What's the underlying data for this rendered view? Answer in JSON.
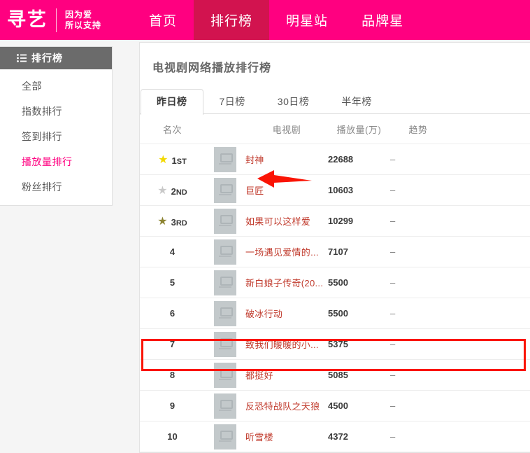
{
  "nav": {
    "logo_text": "寻艺",
    "slogan": "因为爱\n所以支持",
    "items": [
      {
        "label": "首页",
        "active": false
      },
      {
        "label": "排行榜",
        "active": true
      },
      {
        "label": "明星站",
        "active": false
      },
      {
        "label": "品牌星",
        "active": false
      }
    ]
  },
  "sidebar": {
    "header": "排行榜",
    "header_icon": "list-icon",
    "items": [
      {
        "label": "全部",
        "active": false
      },
      {
        "label": "指数排行",
        "active": false
      },
      {
        "label": "签到排行",
        "active": false
      },
      {
        "label": "播放量排行",
        "active": true
      },
      {
        "label": "粉丝排行",
        "active": false
      }
    ]
  },
  "panel": {
    "title": "电视剧网络播放排行榜",
    "tabs": [
      {
        "label": "昨日榜",
        "active": true
      },
      {
        "label": "7日榜",
        "active": false
      },
      {
        "label": "30日榜",
        "active": false
      },
      {
        "label": "半年榜",
        "active": false
      }
    ],
    "columns": [
      "名次",
      "电视剧",
      "播放量(万)",
      "趋势"
    ],
    "rows": [
      {
        "rank": "1",
        "rank_suffix": "ST",
        "medal": "★",
        "medal_class": "m1",
        "thumb": "image-placeholder-icon",
        "name": "封神",
        "views": "22688",
        "trend": "–"
      },
      {
        "rank": "2",
        "rank_suffix": "ND",
        "medal": "★",
        "medal_class": "m2",
        "thumb": "image-placeholder-icon",
        "name": "巨匠",
        "views": "10603",
        "trend": "–"
      },
      {
        "rank": "3",
        "rank_suffix": "RD",
        "medal": "★",
        "medal_class": "m3",
        "thumb": "image-placeholder-icon",
        "name": "如果可以这样爱",
        "views": "10299",
        "trend": "–"
      },
      {
        "rank": "4",
        "rank_suffix": "",
        "medal": "",
        "medal_class": "",
        "thumb": "image-placeholder-icon",
        "name": "一场遇见爱情的...",
        "views": "7107",
        "trend": "–"
      },
      {
        "rank": "5",
        "rank_suffix": "",
        "medal": "",
        "medal_class": "",
        "thumb": "image-placeholder-icon",
        "name": "新白娘子传奇(20...",
        "views": "5500",
        "trend": "–"
      },
      {
        "rank": "6",
        "rank_suffix": "",
        "medal": "",
        "medal_class": "",
        "thumb": "image-placeholder-icon",
        "name": "破冰行动",
        "views": "5500",
        "trend": "–"
      },
      {
        "rank": "7",
        "rank_suffix": "",
        "medal": "",
        "medal_class": "",
        "thumb": "image-placeholder-icon",
        "name": "致我们暖暖的小...",
        "views": "5375",
        "trend": "–"
      },
      {
        "rank": "8",
        "rank_suffix": "",
        "medal": "",
        "medal_class": "",
        "thumb": "image-placeholder-icon",
        "name": "都挺好",
        "views": "5085",
        "trend": "–"
      },
      {
        "rank": "9",
        "rank_suffix": "",
        "medal": "",
        "medal_class": "",
        "thumb": "image-placeholder-icon",
        "name": "反恐特战队之天狼",
        "views": "4500",
        "trend": "–"
      },
      {
        "rank": "10",
        "rank_suffix": "",
        "medal": "",
        "medal_class": "",
        "thumb": "image-placeholder-icon",
        "name": "听雪楼",
        "views": "4372",
        "trend": "–"
      }
    ]
  },
  "annotations": {
    "highlight_color": "#fa1405",
    "arrow_color": "#fa1405",
    "highlight_target_row": "8",
    "arrow_target_row": "2"
  },
  "colors": {
    "nav_bg": "#ff0080",
    "nav_active_bg": "#d2134f",
    "accent": "#ff0080",
    "link": "#c0392b",
    "page_bg": "#f5f5f5"
  }
}
